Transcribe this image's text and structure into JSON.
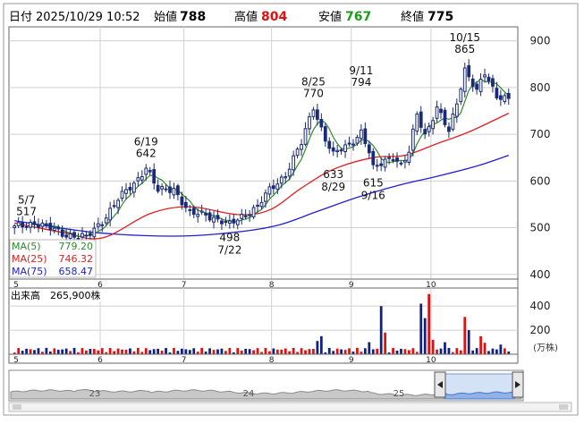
{
  "header": {
    "date_label": "日付",
    "date_value": "2025/10/29 10:52",
    "open_label": "始値",
    "open_value": "788",
    "high_label": "高値",
    "high_value": "804",
    "low_label": "安値",
    "low_value": "767",
    "close_label": "終値",
    "close_value": "775"
  },
  "legend": [
    {
      "name": "MA(5)",
      "value": "779.20",
      "color": "#2e8b2e"
    },
    {
      "name": "MA(25)",
      "value": "746.32",
      "color": "#e02020"
    },
    {
      "name": "MA(75)",
      "value": "658.47",
      "color": "#2020d0"
    }
  ],
  "volume_header": {
    "label": "出来高",
    "value": "265,900株"
  },
  "volume_unit": "(万株)",
  "colors": {
    "up": "#e01010",
    "down": "#102080",
    "ma5": "#2e8b2e",
    "ma25": "#e02020",
    "ma75": "#2020d0",
    "high_text": "#e01010",
    "low_text": "#1a9e1a"
  },
  "chart_data": [
    {
      "type": "candlestick",
      "title": "",
      "ylim": [
        390,
        930
      ],
      "y_ticks": [
        400,
        500,
        600,
        700,
        800,
        900
      ],
      "x_ticks": [
        "5",
        "6",
        "7",
        "8",
        "9",
        "10"
      ],
      "grid": true,
      "y_axis_side": "right",
      "annotations": [
        {
          "date": "5/7",
          "value": 517,
          "position": "above"
        },
        {
          "date": "6/19",
          "value": 642,
          "position": "above"
        },
        {
          "date": "7/22",
          "value": 498,
          "position": "below"
        },
        {
          "date": "8/25",
          "value": 770,
          "position": "above"
        },
        {
          "date": "8/29",
          "value": 633,
          "position": "below"
        },
        {
          "date": "9/11",
          "value": 794,
          "position": "above"
        },
        {
          "date": "9/16",
          "value": 615,
          "position": "below"
        },
        {
          "date": "10/15",
          "value": 865,
          "position": "above"
        }
      ],
      "anchors": [
        {
          "i": 0,
          "v": 500
        },
        {
          "i": 5,
          "v": 512
        },
        {
          "i": 12,
          "v": 488
        },
        {
          "i": 18,
          "v": 478
        },
        {
          "i": 22,
          "v": 515
        },
        {
          "i": 26,
          "v": 560
        },
        {
          "i": 30,
          "v": 595
        },
        {
          "i": 33,
          "v": 630
        },
        {
          "i": 36,
          "v": 578
        },
        {
          "i": 40,
          "v": 585
        },
        {
          "i": 44,
          "v": 528
        },
        {
          "i": 48,
          "v": 530
        },
        {
          "i": 54,
          "v": 505
        },
        {
          "i": 57,
          "v": 525
        },
        {
          "i": 61,
          "v": 545
        },
        {
          "i": 64,
          "v": 580
        },
        {
          "i": 68,
          "v": 615
        },
        {
          "i": 72,
          "v": 680
        },
        {
          "i": 75,
          "v": 760
        },
        {
          "i": 78,
          "v": 690
        },
        {
          "i": 80,
          "v": 655
        },
        {
          "i": 84,
          "v": 680
        },
        {
          "i": 87,
          "v": 705
        },
        {
          "i": 89,
          "v": 660
        },
        {
          "i": 90,
          "v": 625
        },
        {
          "i": 93,
          "v": 645
        },
        {
          "i": 95,
          "v": 655
        },
        {
          "i": 97,
          "v": 630
        },
        {
          "i": 99,
          "v": 660
        },
        {
          "i": 101,
          "v": 745
        },
        {
          "i": 103,
          "v": 700
        },
        {
          "i": 106,
          "v": 755
        },
        {
          "i": 109,
          "v": 705
        },
        {
          "i": 111,
          "v": 770
        },
        {
          "i": 113,
          "v": 840
        },
        {
          "i": 116,
          "v": 790
        },
        {
          "i": 118,
          "v": 830
        },
        {
          "i": 121,
          "v": 785
        },
        {
          "i": 124,
          "v": 775
        }
      ],
      "ma75": [
        [
          0,
          515
        ],
        [
          20,
          490
        ],
        [
          40,
          482
        ],
        [
          55,
          490
        ],
        [
          66,
          505
        ],
        [
          76,
          535
        ],
        [
          86,
          565
        ],
        [
          96,
          590
        ],
        [
          106,
          610
        ],
        [
          116,
          632
        ],
        [
          124,
          655
        ]
      ],
      "ma25": [
        [
          0,
          510
        ],
        [
          12,
          490
        ],
        [
          22,
          478
        ],
        [
          34,
          530
        ],
        [
          44,
          545
        ],
        [
          56,
          528
        ],
        [
          64,
          538
        ],
        [
          72,
          585
        ],
        [
          80,
          625
        ],
        [
          90,
          650
        ],
        [
          98,
          655
        ],
        [
          106,
          680
        ],
        [
          114,
          705
        ],
        [
          124,
          745
        ]
      ],
      "month_boundaries": [
        {
          "i": 0,
          "label": "5"
        },
        {
          "i": 22,
          "label": "6"
        },
        {
          "i": 43,
          "label": "7"
        },
        {
          "i": 65,
          "label": "8"
        },
        {
          "i": 85,
          "label": "9"
        },
        {
          "i": 105,
          "label": "10"
        }
      ]
    },
    {
      "type": "bar",
      "title": "出来高",
      "ylabel": "(万株)",
      "ylim": [
        0,
        550
      ],
      "y_ticks": [
        200,
        400
      ],
      "x_ticks": [
        "5",
        "6",
        "7",
        "8",
        "9",
        "10"
      ],
      "spikes": [
        {
          "i": 76,
          "v": 110
        },
        {
          "i": 77,
          "v": 150
        },
        {
          "i": 89,
          "v": 100
        },
        {
          "i": 92,
          "v": 400
        },
        {
          "i": 93,
          "v": 180
        },
        {
          "i": 102,
          "v": 420
        },
        {
          "i": 103,
          "v": 300
        },
        {
          "i": 104,
          "v": 500
        },
        {
          "i": 105,
          "v": 120
        },
        {
          "i": 108,
          "v": 100
        },
        {
          "i": 113,
          "v": 310
        },
        {
          "i": 114,
          "v": 200
        },
        {
          "i": 117,
          "v": 150
        },
        {
          "i": 118,
          "v": 95
        },
        {
          "i": 122,
          "v": 80
        }
      ],
      "base_volume": 35
    }
  ],
  "navigator": {
    "labels": [
      "23",
      "24",
      "25"
    ]
  }
}
